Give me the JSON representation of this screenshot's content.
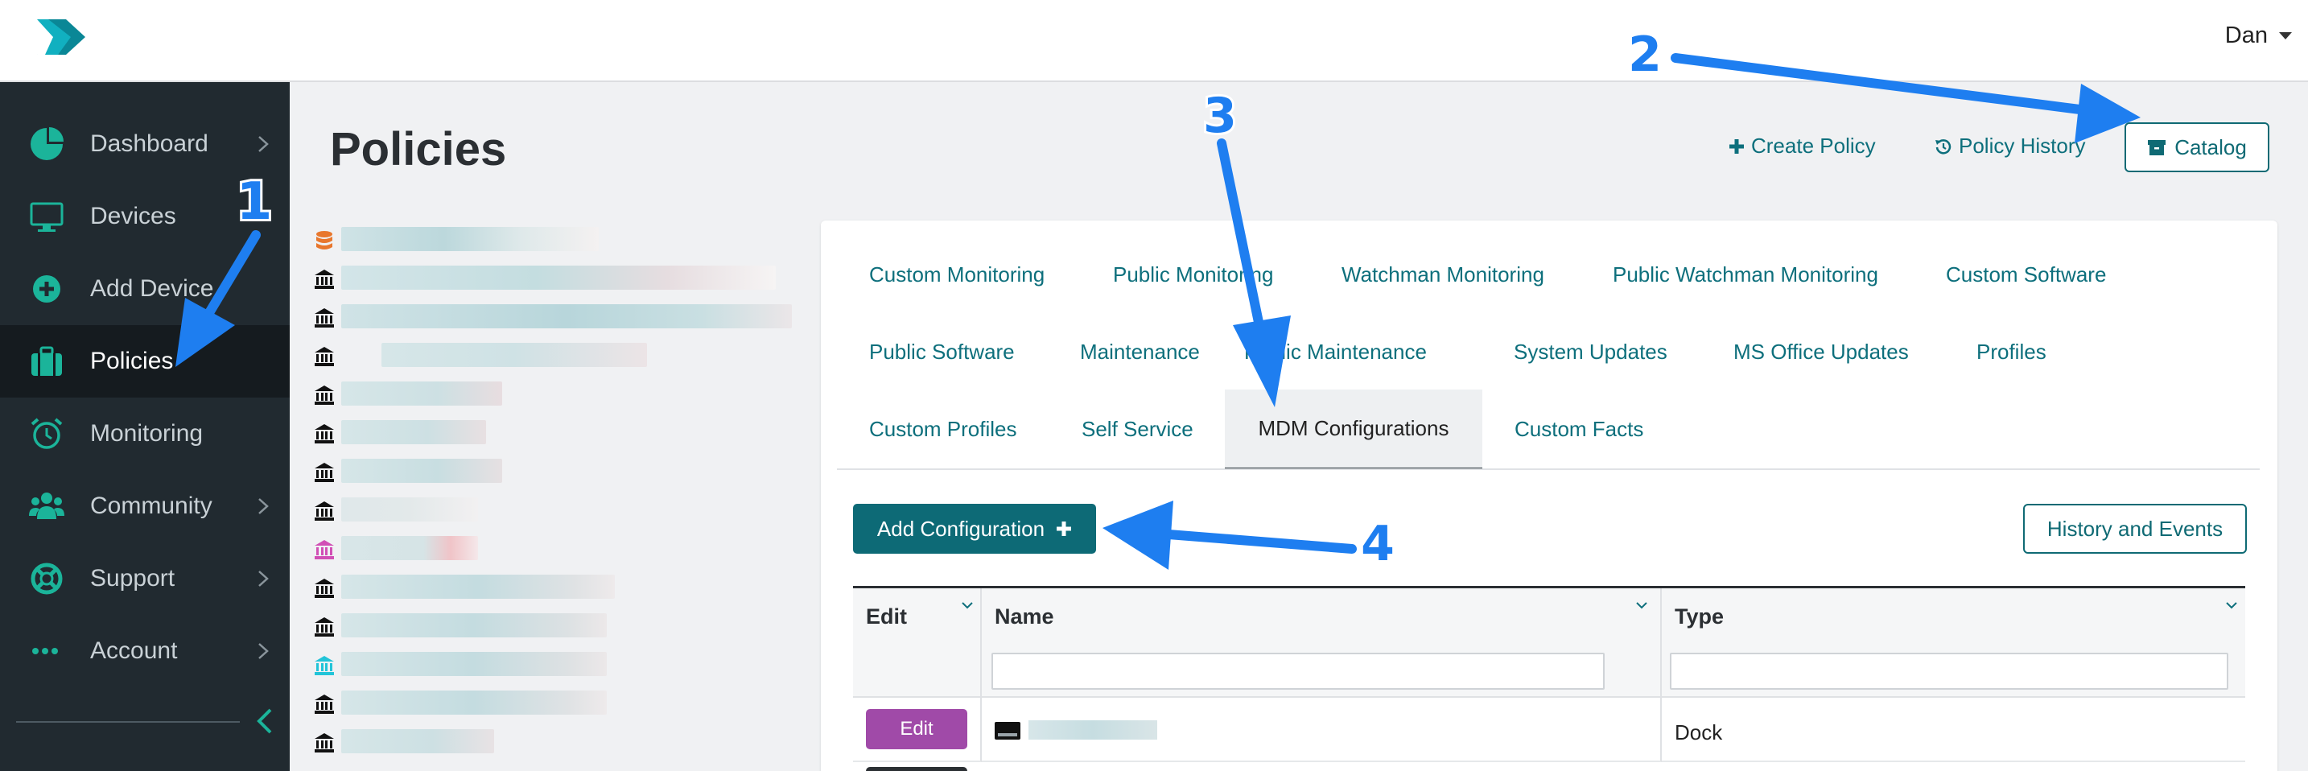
{
  "app": {
    "user_name": "Dan"
  },
  "sidebar": {
    "items": [
      {
        "label": "Dashboard",
        "icon": "pie-chart-icon",
        "has_chevron": true
      },
      {
        "label": "Devices",
        "icon": "monitor-icon",
        "has_chevron": false
      },
      {
        "label": "Add Device",
        "icon": "plus-circle-icon",
        "has_chevron": false
      },
      {
        "label": "Policies",
        "icon": "briefcase-icon",
        "has_chevron": false,
        "active": true
      },
      {
        "label": "Monitoring",
        "icon": "alarm-clock-icon",
        "has_chevron": false
      },
      {
        "label": "Community",
        "icon": "users-icon",
        "has_chevron": true
      },
      {
        "label": "Support",
        "icon": "life-ring-icon",
        "has_chevron": true
      },
      {
        "label": "Account",
        "icon": "ellipsis-icon",
        "has_chevron": true
      }
    ]
  },
  "header": {
    "title": "Policies",
    "create_policy": "Create Policy",
    "policy_history": "Policy History",
    "catalog": "Catalog"
  },
  "tabs": {
    "row1": [
      "Custom Monitoring",
      "Public Monitoring",
      "Watchman Monitoring",
      "Public Watchman Monitoring",
      "Custom Software"
    ],
    "row2": [
      "Public Software",
      "Maintenance",
      "Public Maintenance",
      "System Updates",
      "MS Office Updates",
      "Profiles"
    ],
    "row3": [
      "Custom Profiles",
      "Self Service",
      "Custom Facts"
    ],
    "active": "MDM Configurations"
  },
  "actions": {
    "add_configuration": "Add Configuration",
    "history_events": "History and Events"
  },
  "table": {
    "columns": [
      "Edit",
      "Name",
      "Type"
    ],
    "rows": [
      {
        "edit_label": "Edit",
        "type": "Dock"
      }
    ]
  },
  "annotations": [
    "1",
    "2",
    "3",
    "4"
  ],
  "colors": {
    "accent": "#0d6a76",
    "sidebar_bg": "#212a30",
    "icon_teal": "#1bb49a",
    "edit_purple": "#a04aa8",
    "arrow_blue": "#1e7ef0"
  }
}
